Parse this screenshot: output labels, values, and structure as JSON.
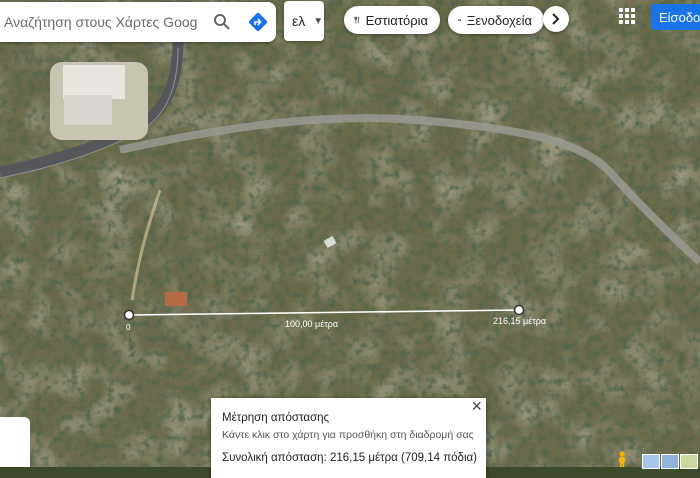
{
  "search": {
    "placeholder": "Αναζήτηση στους Χάρτες Goog"
  },
  "language": {
    "label": "ελ"
  },
  "chips": [
    {
      "label": "Εστιατόρια",
      "icon": "restaurant-icon"
    },
    {
      "label": "Ξενοδοχεία",
      "icon": "hotel-icon"
    }
  ],
  "account": {
    "signin_label": "Είσοδο"
  },
  "measure_line": {
    "start_label": "0",
    "mid_label": "100,00 μέτρα",
    "end_label": "216,15 μέτρα"
  },
  "measure_panel": {
    "title": "Μέτρηση απόστασης",
    "hint": "Κάντε κλικ στο χάρτη για προσθήκη στη διαδρομή σας",
    "total": "Συνολική απόσταση: 216,15 μέτρα (709,14 πόδια)",
    "close": "×"
  },
  "colors": {
    "accent": "#1a73e8",
    "directions": "#1a73e8"
  }
}
